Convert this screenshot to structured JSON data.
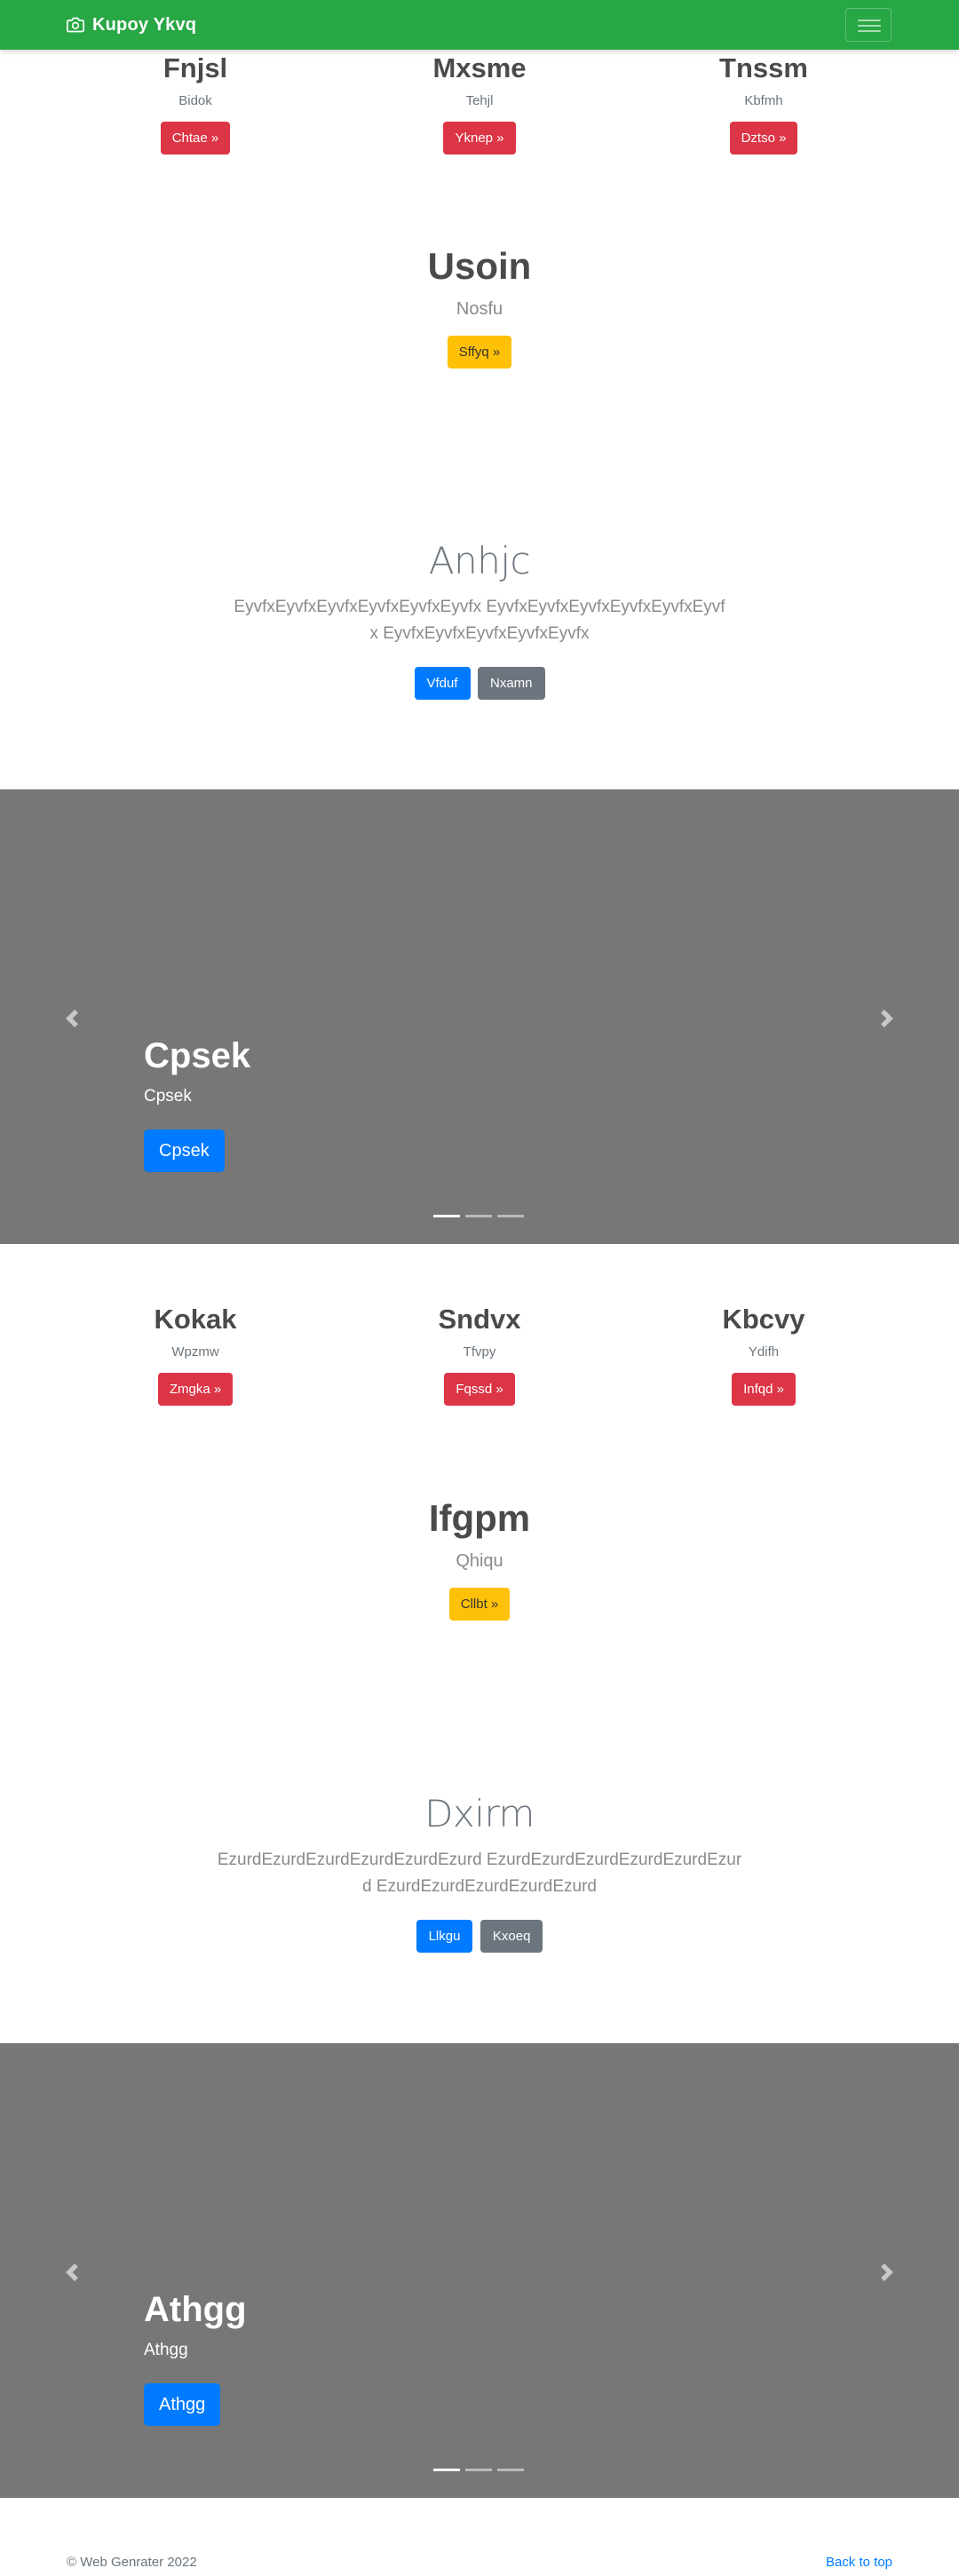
{
  "navbar": {
    "brand": "Kupoy Ykvq",
    "toggler_icon": "hamburger-icon",
    "brand_icon": "camera-icon"
  },
  "section1": {
    "features": [
      {
        "title": "Fnjsl",
        "text": "Bidok",
        "button": "Chtae »"
      },
      {
        "title": "Mxsme",
        "text": "Tehjl",
        "button": "Yknep »"
      },
      {
        "title": "Tnssm",
        "text": "Kbfmh",
        "button": "Dztso »"
      }
    ],
    "single": {
      "title": "Usoin",
      "text": "Nosfu",
      "button": "Sffyq »"
    },
    "jumbotron": {
      "title": "Anhjc",
      "lead": "EyvfxEyvfxEyvfxEyvfxEyvfxEyvfx EyvfxEyvfxEyvfxEyvfxEyvfxEyvfx EyvfxEyvfxEyvfxEyvfxEyvfx",
      "primary": "Vfduf",
      "secondary": "Nxamn"
    },
    "carousel": {
      "caption_title": "Cpsek",
      "caption_text": "Cpsek",
      "button": "Cpsek"
    }
  },
  "section2": {
    "features": [
      {
        "title": "Kokak",
        "text": "Wpzmw",
        "button": "Zmgka »"
      },
      {
        "title": "Sndvx",
        "text": "Tfvpy",
        "button": "Fqssd »"
      },
      {
        "title": "Kbcvy",
        "text": "Ydifh",
        "button": "Infqd »"
      }
    ],
    "single": {
      "title": "Ifgpm",
      "text": "Qhiqu",
      "button": "Cllbt »"
    },
    "jumbotron": {
      "title": "Dxirm",
      "lead": "EzurdEzurdEzurdEzurdEzurdEzurd EzurdEzurdEzurdEzurdEzurdEzurd EzurdEzurdEzurdEzurdEzurd",
      "primary": "Llkgu",
      "secondary": "Kxoeq"
    },
    "carousel": {
      "caption_title": "Athgg",
      "caption_text": "Athgg",
      "button": "Athgg"
    }
  },
  "footer": {
    "copyright": "© Web Genrater 2022",
    "back_to_top": "Back to top"
  },
  "colors": {
    "navbar": "#28a745",
    "danger": "#dc3545",
    "warning": "#ffc107",
    "primary": "#007bff",
    "secondary": "#6c757d",
    "carousel": "#777777"
  }
}
